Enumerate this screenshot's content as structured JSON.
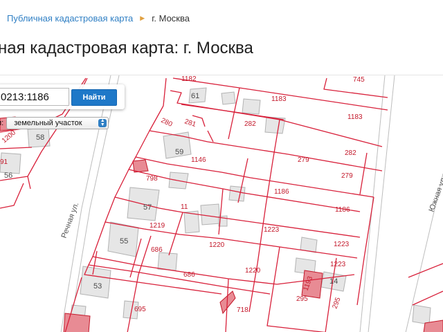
{
  "breadcrumb": {
    "link": "Публичная кадастровая карта",
    "current": "г. Москва"
  },
  "page_title": "ная кадастровая карта: г. Москва",
  "search": {
    "value": "0213:1186",
    "button_label": "Найти",
    "type_label": "и:",
    "type_value": "земельный участок"
  },
  "map": {
    "streets": [
      "Речная ул.",
      "Южная ул."
    ],
    "parcel_labels": [
      "1183",
      "1183",
      "282",
      "282",
      "280",
      "281",
      "279",
      "279",
      "1146",
      "798",
      "11",
      "1186",
      "1186",
      "1219",
      "1223",
      "1223",
      "1220",
      "1220",
      "686",
      "686",
      "695",
      "718",
      "1223",
      "295",
      "295",
      "1200",
      "1193",
      "61"
    ],
    "building_numbers": [
      "61",
      "59",
      "58",
      "57",
      "56",
      "55",
      "53",
      "14"
    ]
  },
  "colors": {
    "parcel_line": "#d8203a",
    "link": "#2f7fc4",
    "button": "#1e78c8",
    "separator": "#e0a040"
  }
}
